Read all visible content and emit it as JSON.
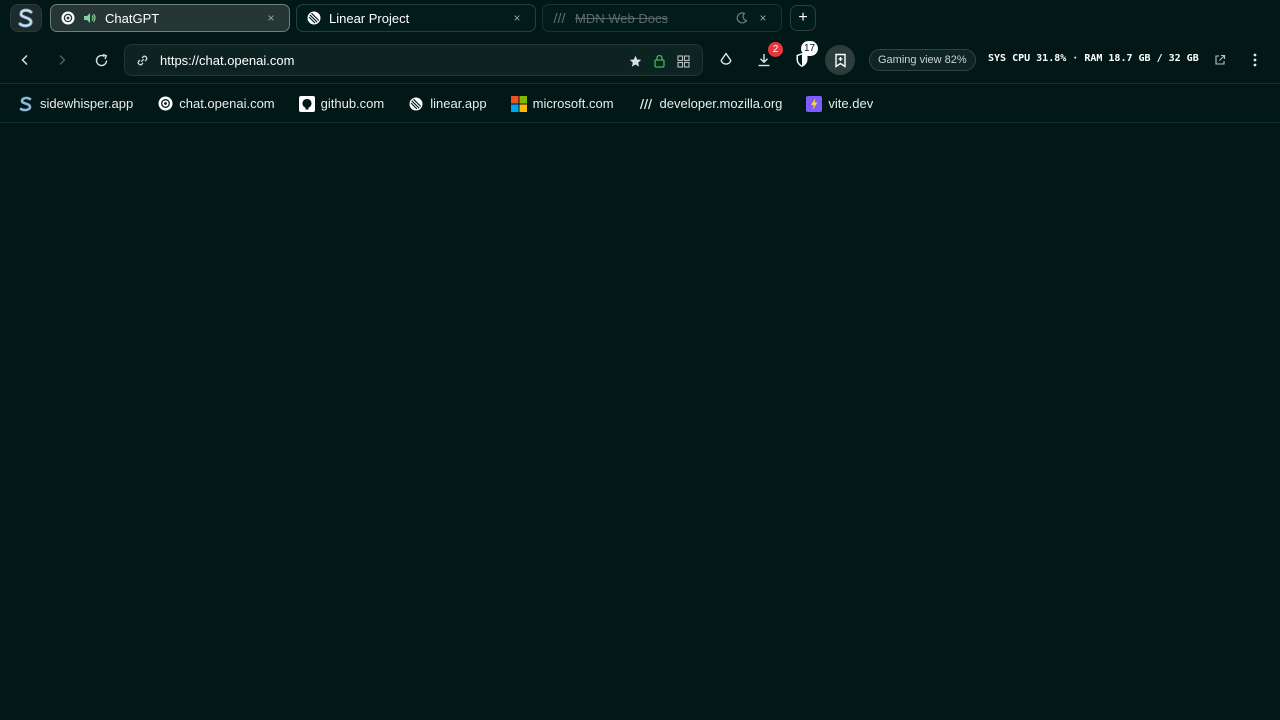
{
  "tabs": [
    {
      "title": "ChatGPT",
      "state": "active",
      "icon": "openai-icon",
      "audio": true
    },
    {
      "title": "Linear Project",
      "state": "inactive",
      "icon": "linear-icon"
    },
    {
      "title": "MDN Web Docs",
      "state": "sleeping",
      "icon": "mdn-icon"
    }
  ],
  "new_tab_label": "+",
  "close_glyph": "×",
  "address": {
    "url": "https://chat.openai.com"
  },
  "toolbar": {
    "downloads_badge": "2",
    "shield_badge": "17",
    "gaming_view": "Gaming view 82%",
    "sys_monitor": "SYS CPU 31.8% · RAM 18.7 GB / 32 GB"
  },
  "bookmarks": [
    {
      "label": "sidewhisper.app",
      "icon": "sidewhisper-icon"
    },
    {
      "label": "chat.openai.com",
      "icon": "openai-icon"
    },
    {
      "label": "github.com",
      "icon": "github-icon"
    },
    {
      "label": "linear.app",
      "icon": "linear-icon"
    },
    {
      "label": "microsoft.com",
      "icon": "microsoft-icon"
    },
    {
      "label": "developer.mozilla.org",
      "icon": "mdn-icon"
    },
    {
      "label": "vite.dev",
      "icon": "vite-icon"
    }
  ],
  "colors": {
    "background": "#011817",
    "badge_red": "#e5383b",
    "lock_green": "#3fb950"
  }
}
